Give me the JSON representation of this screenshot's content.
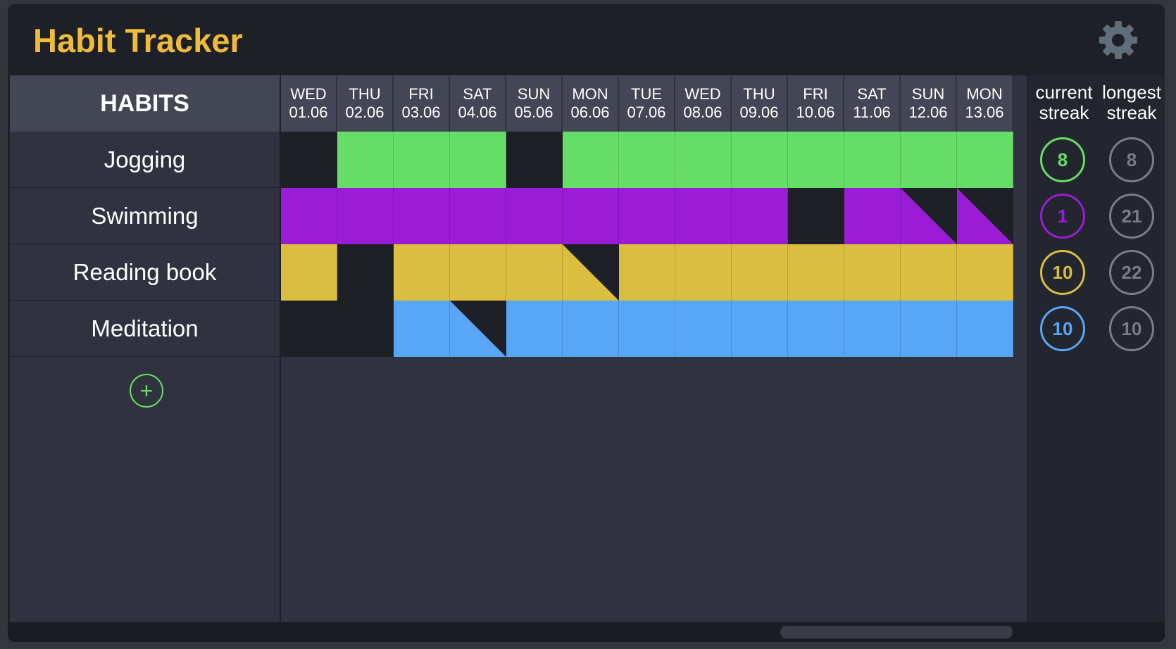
{
  "app": {
    "title": "Habit Tracker"
  },
  "icons": {
    "settings": "gear-icon",
    "add": "plus-icon"
  },
  "colors": {
    "title": "#f0bb3b",
    "empty_cell": "#1e2028",
    "jogging": "#66dd66",
    "swimming": "#9b1cd6",
    "reading": "#dbbe3f",
    "meditation": "#58a6f7",
    "longest_badge": "#7a7d85"
  },
  "habits_header": "HABITS",
  "days": [
    {
      "dow": "WED",
      "date": "01.06"
    },
    {
      "dow": "THU",
      "date": "02.06"
    },
    {
      "dow": "FRI",
      "date": "03.06"
    },
    {
      "dow": "SAT",
      "date": "04.06"
    },
    {
      "dow": "SUN",
      "date": "05.06"
    },
    {
      "dow": "MON",
      "date": "06.06"
    },
    {
      "dow": "TUE",
      "date": "07.06"
    },
    {
      "dow": "WED",
      "date": "08.06"
    },
    {
      "dow": "THU",
      "date": "09.06"
    },
    {
      "dow": "FRI",
      "date": "10.06"
    },
    {
      "dow": "SAT",
      "date": "11.06"
    },
    {
      "dow": "SUN",
      "date": "12.06"
    },
    {
      "dow": "MON",
      "date": "13.06"
    }
  ],
  "habits": [
    {
      "name": "Jogging",
      "color": "#66dd66",
      "current_streak": "8",
      "longest_streak": "8",
      "status": [
        "none",
        "done",
        "done",
        "done",
        "none",
        "done",
        "done",
        "done",
        "done",
        "done",
        "done",
        "done",
        "done"
      ]
    },
    {
      "name": "Swimming",
      "color": "#9b1cd6",
      "current_streak": "1",
      "longest_streak": "21",
      "status": [
        "done",
        "done",
        "done",
        "done",
        "done",
        "done",
        "done",
        "done",
        "done",
        "none",
        "done",
        "half",
        "half"
      ]
    },
    {
      "name": "Reading book",
      "color": "#dbbe3f",
      "current_streak": "10",
      "longest_streak": "22",
      "status": [
        "done",
        "none",
        "done",
        "done",
        "done",
        "half",
        "done",
        "done",
        "done",
        "done",
        "done",
        "done",
        "done"
      ]
    },
    {
      "name": "Meditation",
      "color": "#58a6f7",
      "current_streak": "10",
      "longest_streak": "10",
      "status": [
        "none",
        "none",
        "done",
        "half",
        "done",
        "done",
        "done",
        "done",
        "done",
        "done",
        "done",
        "done",
        "done"
      ]
    }
  ],
  "stats": {
    "current_label": "current streak",
    "longest_label": "longest streak"
  }
}
